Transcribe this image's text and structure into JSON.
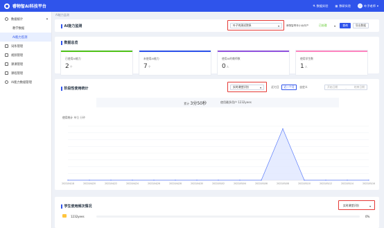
{
  "app": {
    "title": "睿物智AI科技平台",
    "nav_left": "数据实验",
    "nav_mid": "数研实验",
    "user": "叶子老师"
  },
  "breadcrumb": "AI能力监测",
  "sidebar": {
    "items": [
      {
        "label": "数据统计",
        "type": "parent"
      },
      {
        "label": "教学数据",
        "type": "sub"
      },
      {
        "label": "AI能力监测",
        "type": "sub"
      },
      {
        "label": "词条管理",
        "type": "parent"
      },
      {
        "label": "视频管理",
        "type": "parent"
      },
      {
        "label": "课课管理",
        "type": "parent"
      },
      {
        "label": "课程管理",
        "type": "parent"
      },
      {
        "label": "AI能力数据管理",
        "type": "parent"
      }
    ]
  },
  "section1": {
    "title": "AI能力监测",
    "school_select": "叶子的测试院系",
    "filter_label": "睿物智青年小伙伴产",
    "status": "已处理",
    "query": "查询",
    "export": "导出数据"
  },
  "section2": {
    "title": "数据总览",
    "stats": [
      {
        "label": "已使用AI能力",
        "value": "2",
        "unit": "个",
        "color": "#52c41a"
      },
      {
        "label": "未使用AI能力",
        "value": "7",
        "unit": "个",
        "color": "#2f54eb"
      },
      {
        "label": "使用AI的教师数",
        "value": "0",
        "unit": "人",
        "color": "#9254de"
      },
      {
        "label": "使用学生数",
        "value": "1",
        "unit": "人",
        "color": "#ff85c0"
      }
    ]
  },
  "section3": {
    "title": "阶段性使用统计",
    "select": "实时课堂识别",
    "seven": "近七日",
    "month": "近一个月",
    "custom": "自定义",
    "start": "开始日期",
    "end": "结束日期",
    "total_label": "累计",
    "total_value": "3分50秒",
    "users": "使用最多用户 1232yees",
    "legend_title": "使用统计",
    "legend_a": "单位",
    "legend_b": "分钟"
  },
  "chart_data": {
    "type": "line",
    "x": [
      "2022/04/18",
      "2022/04/20",
      "2022/04/22",
      "2022/04/24",
      "2022/04/26",
      "2022/04/28",
      "2022/04/30",
      "2022/05/02",
      "2022/05/04",
      "2022/05/06",
      "2022/05/08",
      "2022/05/10",
      "2022/05/12",
      "2022/05/14",
      "2022/05/16"
    ],
    "values": [
      0,
      0,
      0,
      0,
      0,
      0,
      0,
      0,
      0,
      0,
      3.8,
      0,
      0,
      0,
      0
    ],
    "yticks": [
      "0",
      "0.5",
      "1",
      "1.5",
      "2",
      "2.5",
      "3",
      "3.5",
      "4"
    ],
    "ylim": [
      0,
      4
    ]
  },
  "section4": {
    "title": "学生使用频次情况",
    "select": "实时课堂识别",
    "row_user": "1232yees",
    "row_pct": "0%"
  }
}
